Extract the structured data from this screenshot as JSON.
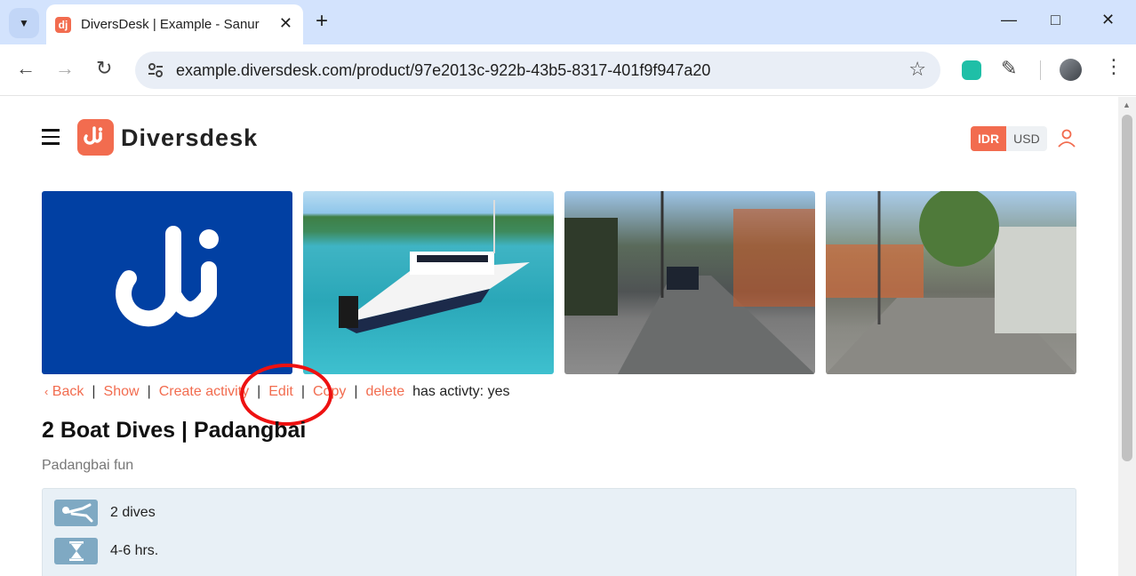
{
  "browser": {
    "tab_title": "DiversDesk | Example - Sanur",
    "tab_favicon_text": "dj",
    "url": "example.diversdesk.com/product/97e2013c-922b-43b5-8317-401f9f947a20"
  },
  "header": {
    "brand": "Diversdesk",
    "currencies": [
      "IDR",
      "USD"
    ],
    "active_currency": "IDR"
  },
  "gallery": {
    "images": [
      "diversdesk-logo",
      "dive-boat",
      "street-view-1",
      "street-view-2"
    ]
  },
  "actions": {
    "back": "Back",
    "show": "Show",
    "create_activity": "Create activity",
    "edit": "Edit",
    "copy": "Copy",
    "delete": "delete",
    "status": "has activty: yes"
  },
  "product": {
    "title": "2 Boat Dives | Padangbai",
    "subtitle": "Padangbai fun",
    "details": [
      {
        "icon": "diver-icon",
        "text": "2 dives"
      },
      {
        "icon": "hourglass-icon",
        "text": "4-6 hrs."
      }
    ]
  },
  "colors": {
    "accent": "#f26c4f",
    "logo_bg": "#0140a3",
    "highlight": "#ee1111"
  }
}
